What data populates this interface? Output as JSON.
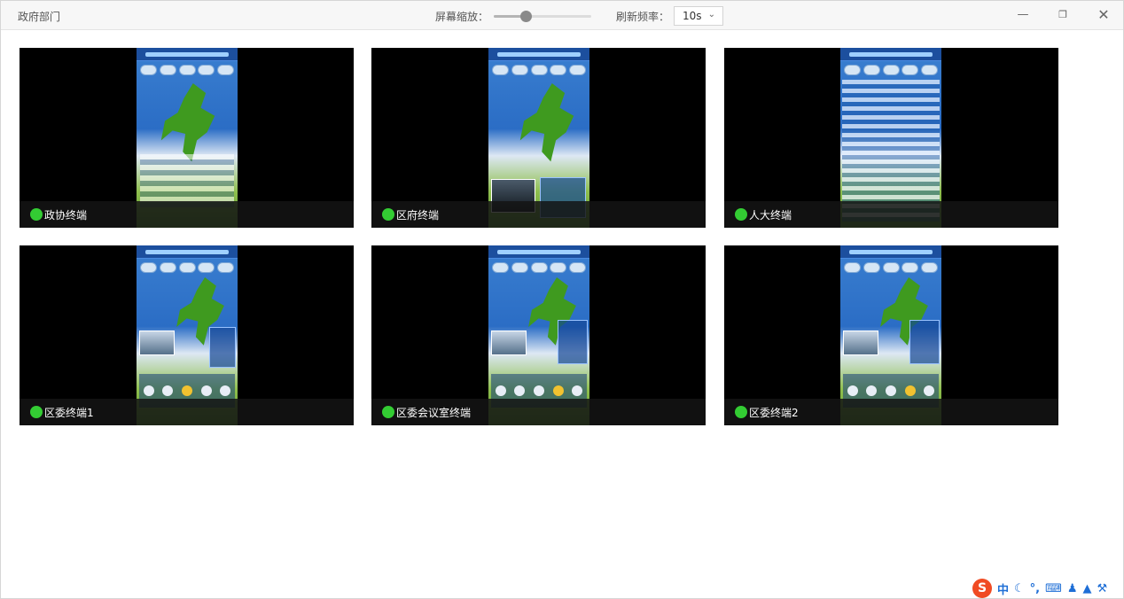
{
  "window": {
    "title": "政府部门",
    "zoom_label": "屏幕缩放：",
    "zoom_level": 0.33,
    "rate_label": "刷新频率：",
    "rate_value": "10s",
    "controls": {
      "minimize": "—",
      "maximize": "❐",
      "close": "✕"
    }
  },
  "tiles": [
    {
      "label": "政协终端",
      "status_color": "#33cc33"
    },
    {
      "label": "区府终端",
      "status_color": "#33cc33"
    },
    {
      "label": "人大终端",
      "status_color": "#33cc33"
    },
    {
      "label": "区委终端1",
      "status_color": "#33cc33"
    },
    {
      "label": "区委会议室终端",
      "status_color": "#33cc33"
    },
    {
      "label": "区委终端2",
      "status_color": "#33cc33"
    }
  ],
  "ime_toolbar": {
    "logo": "S",
    "mode": "中",
    "icons": [
      "moon-icon",
      "punctuation-icon",
      "keyboard-icon",
      "user-icon",
      "shirt-icon",
      "wrench-icon"
    ]
  }
}
